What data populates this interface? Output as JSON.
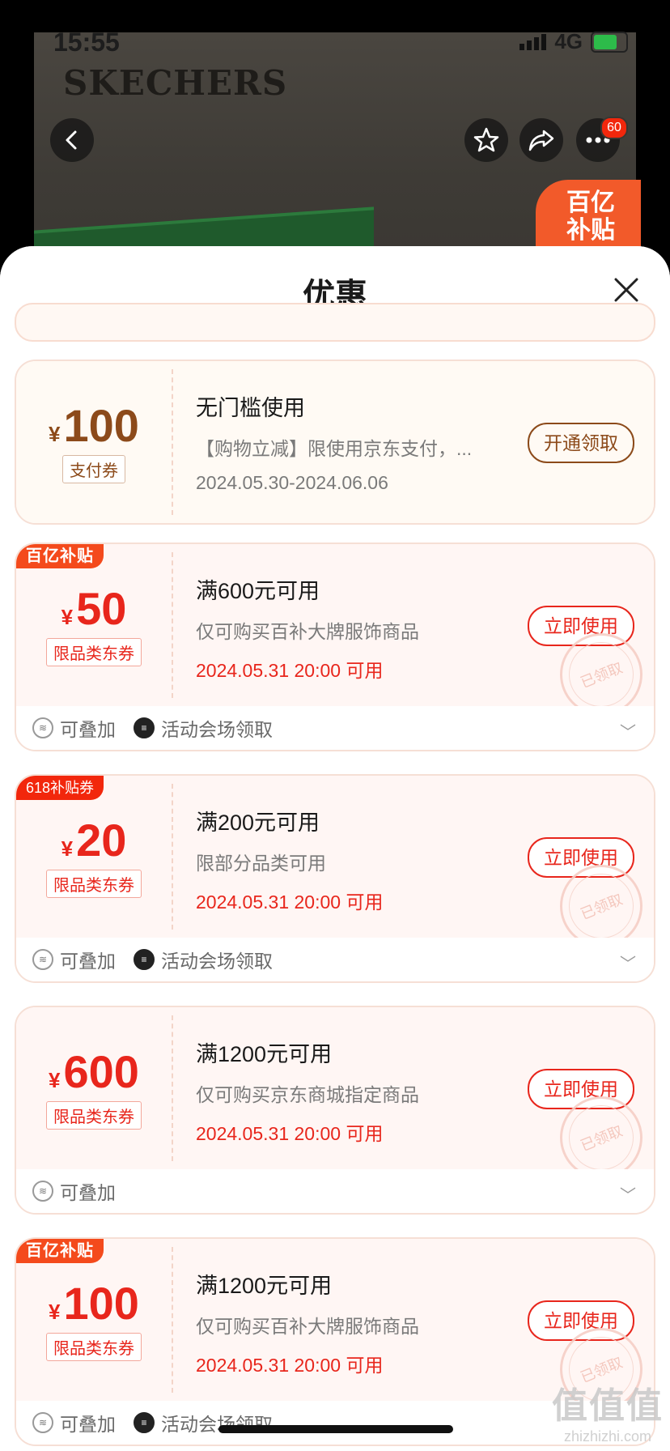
{
  "status": {
    "time": "15:55",
    "network": "4G"
  },
  "background": {
    "brand": "SKECHERS",
    "more_badge": "60",
    "subsidy_badge_line1": "百亿",
    "subsidy_badge_line2": "补贴"
  },
  "sheet": {
    "title": "优惠"
  },
  "coupons": [
    {
      "currency": "¥",
      "amount": "100",
      "tag": "支付券",
      "condition": "无门槛使用",
      "desc": "【购物立减】限使用京东支付，...",
      "date": "2024.05.30-2024.06.06",
      "button": "开通领取"
    },
    {
      "corner": "百亿补贴",
      "currency": "¥",
      "amount": "50",
      "tag": "限品类东券",
      "condition": "满600元可用",
      "desc": "仅可购买百补大牌服饰商品",
      "date": "2024.05.31 20:00 可用",
      "button": "立即使用",
      "stamp": "已领取",
      "footer": [
        "可叠加",
        "活动会场领取"
      ]
    },
    {
      "corner": "618补贴券",
      "currency": "¥",
      "amount": "20",
      "tag": "限品类东券",
      "condition": "满200元可用",
      "desc": "限部分品类可用",
      "date": "2024.05.31 20:00 可用",
      "button": "立即使用",
      "stamp": "已领取",
      "footer": [
        "可叠加",
        "活动会场领取"
      ]
    },
    {
      "currency": "¥",
      "amount": "600",
      "tag": "限品类东券",
      "condition": "满1200元可用",
      "desc": "仅可购买京东商城指定商品",
      "date": "2024.05.31 20:00 可用",
      "button": "立即使用",
      "stamp": "已领取",
      "footer": [
        "可叠加"
      ]
    },
    {
      "corner": "百亿补贴",
      "currency": "¥",
      "amount": "100",
      "tag": "限品类东券",
      "condition": "满1200元可用",
      "desc": "仅可购买百补大牌服饰商品",
      "date": "2024.05.31 20:00 可用",
      "button": "立即使用",
      "stamp": "已领取",
      "footer": [
        "可叠加",
        "活动会场领取"
      ]
    }
  ],
  "watermark": {
    "big": "值值值",
    "small": "zhizhizhi.com"
  },
  "colors": {
    "accent": "#e8261c",
    "pay_brown": "#8c4a1a",
    "subsidy_orange": "#f25a2a"
  }
}
